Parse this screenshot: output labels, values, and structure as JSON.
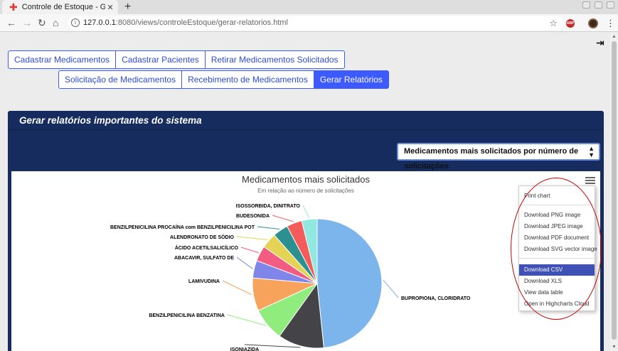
{
  "browser": {
    "tab_title": "Controle de Estoque - Ger",
    "tab_close": "✕",
    "new_tab": "+",
    "url_host": "127.0.0.1",
    "url_rest": ":8080/views/controleEstoque/gerar-relatorios.html",
    "abp_label": "ABP"
  },
  "nav": {
    "row1": [
      "Cadastrar Medicamentos",
      "Cadastrar Pacientes",
      "Retirar Medicamentos Solicitados"
    ],
    "row2": [
      "Solicitação de Medicamentos",
      "Recebimento de Medicamentos",
      "Gerar Relatórios"
    ],
    "active": "Gerar Relatórios"
  },
  "panel": {
    "title": "Gerar relatórios importantes do sistema",
    "select_value": "Medicamentos mais solicitados por número de solicitações"
  },
  "chart_data": {
    "type": "pie",
    "title": "Medicamentos mais solicitados",
    "subtitle": "Em relação ao número de solicitações",
    "values": [
      {
        "label": "BUPROPIONA, CLORIDRATO",
        "value": 44,
        "color": "#7cb5ec"
      },
      {
        "label": "ISONIAZIDA",
        "value": 10.5,
        "color": "#434348"
      },
      {
        "label": "BENZILPENICILINA BENZATINA",
        "value": 7.5,
        "color": "#90ed7d"
      },
      {
        "label": "LAMIVUDINA",
        "value": 7.5,
        "color": "#f7a35c"
      },
      {
        "label": "ABACAVIR, SULFATO DE",
        "value": 4,
        "color": "#8085e9"
      },
      {
        "label": "ÁCIDO ACETILSALICÍLICO",
        "value": 3.5,
        "color": "#f15c80"
      },
      {
        "label": "ALENDRONATO DE SÓDIO",
        "value": 3.5,
        "color": "#e4d354"
      },
      {
        "label": "BENZILPENICILINA PROCAÍNA com BENZILPENICILINA POT",
        "value": 3.5,
        "color": "#2b908f"
      },
      {
        "label": "BUDESONIDA",
        "value": 3.5,
        "color": "#f45b5b"
      },
      {
        "label": "ISOSSORBIDA, DINITRATO",
        "value": 3.5,
        "color": "#91e8e1"
      }
    ]
  },
  "export_menu": {
    "items": [
      "Print chart",
      "Download PNG image",
      "Download JPEG image",
      "Download PDF document",
      "Download SVG vector image",
      "Download CSV",
      "Download XLS",
      "View data table",
      "Open in Highcharts Cloud"
    ],
    "highlighted": "Download CSV"
  }
}
